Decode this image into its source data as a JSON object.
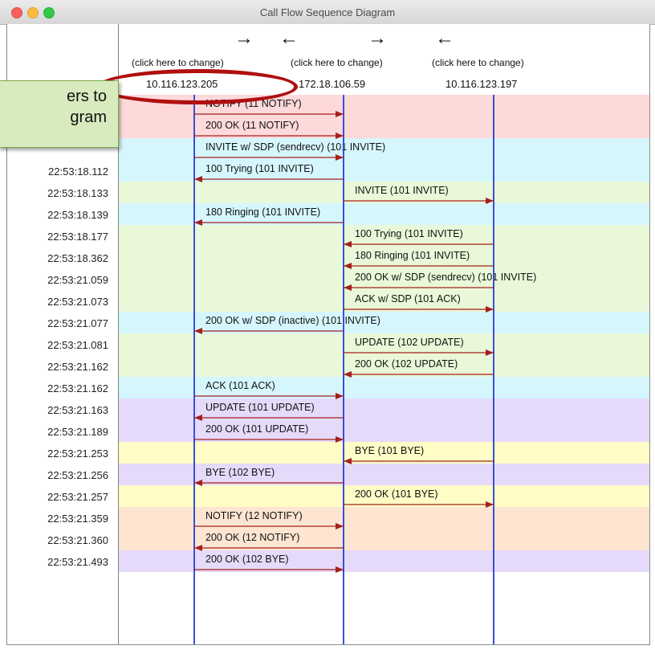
{
  "window": {
    "title": "Call Flow Sequence Diagram"
  },
  "colors": {
    "red": "#fdd9da",
    "cyan": "#d6f6fd",
    "green": "#e9f8d8",
    "purple": "#e6dafb",
    "yellow": "#fffcc6",
    "peach": "#fde5d2",
    "lifeline": "#3a4ed8",
    "arrow": "#a3201e",
    "callout": "#d8ebbf",
    "ellipse": "#b00f0f"
  },
  "header": {
    "columns": [
      {
        "arrow": "→",
        "change_label": "(click here to change)",
        "ip": "10.116.123.205"
      },
      {
        "arrow": "←",
        "change_label": "(click here to change)",
        "ip": "172.18.106.59"
      },
      {
        "arrow": "→",
        "change_label": "(click here to change)",
        "ip": "10.116.123.197"
      },
      {
        "arrow": "←",
        "change_label": ""
      }
    ]
  },
  "callout": {
    "line1": "ers to",
    "line2": "gram"
  },
  "lifelines": [
    "A",
    "B",
    "C"
  ],
  "rows": [
    {
      "time": "",
      "color": "red",
      "from": "A",
      "to": "B",
      "label": "NOTIFY (11 NOTIFY)"
    },
    {
      "time": "",
      "color": "red",
      "from": "A",
      "to": "B",
      "label": "200 OK (11 NOTIFY)"
    },
    {
      "time": "",
      "color": "cyan",
      "from": "A",
      "to": "B",
      "label": "INVITE w/ SDP (sendrecv)  (101 INVITE)"
    },
    {
      "time": "22:53:18.112",
      "color": "cyan",
      "from": "B",
      "to": "A",
      "label": "100 Trying (101 INVITE)"
    },
    {
      "time": "22:53:18.133",
      "color": "green",
      "from": "B",
      "to": "C",
      "label": "INVITE (101 INVITE)"
    },
    {
      "time": "22:53:18.139",
      "color": "cyan",
      "from": "B",
      "to": "A",
      "label": "180 Ringing (101 INVITE)"
    },
    {
      "time": "22:53:18.177",
      "color": "green",
      "from": "C",
      "to": "B",
      "label": "100 Trying (101 INVITE)"
    },
    {
      "time": "22:53:18.362",
      "color": "green",
      "from": "C",
      "to": "B",
      "label": "180 Ringing (101 INVITE)"
    },
    {
      "time": "22:53:21.059",
      "color": "green",
      "from": "C",
      "to": "B",
      "label": "200 OK w/ SDP (sendrecv)  (101 INVITE)"
    },
    {
      "time": "22:53:21.073",
      "color": "green",
      "from": "B",
      "to": "C",
      "label": "ACK w/ SDP (101 ACK)"
    },
    {
      "time": "22:53:21.077",
      "color": "cyan",
      "from": "B",
      "to": "A",
      "label": "200 OK w/ SDP (inactive)  (101 INVITE)"
    },
    {
      "time": "22:53:21.081",
      "color": "green",
      "from": "B",
      "to": "C",
      "label": "UPDATE (102 UPDATE)"
    },
    {
      "time": "22:53:21.162",
      "color": "green",
      "from": "C",
      "to": "B",
      "label": "200 OK (102 UPDATE)"
    },
    {
      "time": "22:53:21.162",
      "color": "cyan",
      "from": "A",
      "to": "B",
      "label": "ACK (101 ACK)"
    },
    {
      "time": "22:53:21.163",
      "color": "purple",
      "from": "B",
      "to": "A",
      "label": "UPDATE (101 UPDATE)"
    },
    {
      "time": "22:53:21.189",
      "color": "purple",
      "from": "A",
      "to": "B",
      "label": "200 OK (101 UPDATE)"
    },
    {
      "time": "22:53:21.253",
      "color": "yellow",
      "from": "C",
      "to": "B",
      "label": "BYE (101 BYE)"
    },
    {
      "time": "22:53:21.256",
      "color": "purple",
      "from": "B",
      "to": "A",
      "label": "BYE (102 BYE)"
    },
    {
      "time": "22:53:21.257",
      "color": "yellow",
      "from": "B",
      "to": "C",
      "label": "200 OK (101 BYE)"
    },
    {
      "time": "22:53:21.359",
      "color": "peach",
      "from": "A",
      "to": "B",
      "label": "NOTIFY (12 NOTIFY)"
    },
    {
      "time": "22:53:21.360",
      "color": "peach",
      "from": "B",
      "to": "A",
      "label": "200 OK (12 NOTIFY)"
    },
    {
      "time": "22:53:21.493",
      "color": "purple",
      "from": "A",
      "to": "B",
      "label": "200 OK (102 BYE)"
    }
  ]
}
